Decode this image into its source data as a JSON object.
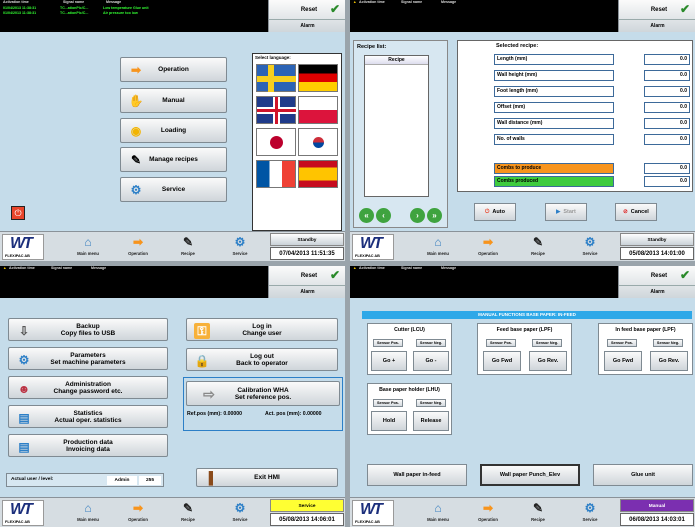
{
  "header": {
    "col_time": "Activation time",
    "col_signal": "Signal name",
    "col_message": "Message",
    "reset": "Reset",
    "alarm": "Alarm"
  },
  "footer": {
    "logo": "WT",
    "company": "FLEXIPAC AB",
    "main_menu": "Main menu",
    "operation": "Operation",
    "recipe": "Recipe",
    "service": "Service"
  },
  "screen1": {
    "alarms": [
      {
        "time": "01/04/2013 11:38:31",
        "signal": "TC...ationPlc/C...",
        "message": "Low temperature Glue unit"
      },
      {
        "time": "01/04/2013 11:38:31",
        "signal": "TC...ationPlc/C...",
        "message": "Air pressure too low"
      }
    ],
    "menu": [
      "Operation",
      "Manual",
      "Loading",
      "Manage recipes",
      "Service"
    ],
    "lang_title": "Select language:",
    "status": "Standby",
    "clock": "07/04/2013 11:51:35"
  },
  "screen2": {
    "recipe_list": "Recipe list:",
    "recipe_col": "Recipe",
    "selected": "Selected recipe:",
    "fields": [
      {
        "label": "Length (mm)",
        "value": "0.0"
      },
      {
        "label": "Wall height (mm)",
        "value": "0.0"
      },
      {
        "label": "Foot length (mm)",
        "value": "0.0"
      },
      {
        "label": "Offset (mm)",
        "value": "0.0"
      },
      {
        "label": "Wall distance (mm)",
        "value": "0.0"
      },
      {
        "label": "No. of walls",
        "value": "0.0"
      }
    ],
    "combs_to_produce": "Combs to produce",
    "combs_to_produce_val": "0.0",
    "combs_produced": "Combs produced",
    "combs_produced_val": "0.0",
    "auto": "Auto",
    "start": "Start",
    "cancel": "Cancel",
    "status": "Standby",
    "clock": "05/08/2013 14:01:00"
  },
  "screen3": {
    "buttons": [
      {
        "l1": "Backup",
        "l2": "Copy files to USB"
      },
      {
        "l1": "Parameters",
        "l2": "Set machine parameters"
      },
      {
        "l1": "Administration",
        "l2": "Change password etc."
      },
      {
        "l1": "Statistics",
        "l2": "Actual oper. statistics"
      },
      {
        "l1": "Production data",
        "l2": "Invoicing data"
      }
    ],
    "login_l1": "Log in",
    "login_l2": "Change user",
    "logout_l1": "Log out",
    "logout_l2": "Back to operator",
    "calib_l1": "Calibration WHA",
    "calib_l2": "Set reference pos.",
    "refpos": "Ref.pos (mm): 0.00000",
    "actpos": "Act. pos (mm): 0.00000",
    "user_label": "Actual user / level:",
    "user": "Admin",
    "level": "255",
    "exit": "Exit HMI",
    "status": "Service",
    "clock": "05/08/2013 14:06:01"
  },
  "screen4": {
    "banner": "MANUAL FUNCTIONS BASE PAPER: IN-FEED",
    "groups": [
      {
        "title": "Cutter (LCU)",
        "b1": "Go +",
        "b2": "Go -"
      },
      {
        "title": "Feed base paper (LPF)",
        "b1": "Go Fwd",
        "b2": "Go Rev."
      },
      {
        "title": "In feed base paper (LPF)",
        "b1": "Go Fwd",
        "b2": "Go Rev."
      },
      {
        "title": "Base paper holder (LHU)",
        "b1": "Hold",
        "b2": "Release"
      }
    ],
    "sensor_pos": "Sensor Pos.",
    "sensor_neg": "Sensor Neg.",
    "bottom": [
      "Wall paper in-feed",
      "Wall paper Punch_Elev",
      "Glue unit"
    ],
    "status": "Manual",
    "clock": "06/08/2013 14:03:01"
  },
  "colors": {
    "status_yellow": "#ffff33",
    "manual_purple": "#7b2fb0",
    "orange": "#f7941d",
    "green": "#3ecb3e"
  }
}
